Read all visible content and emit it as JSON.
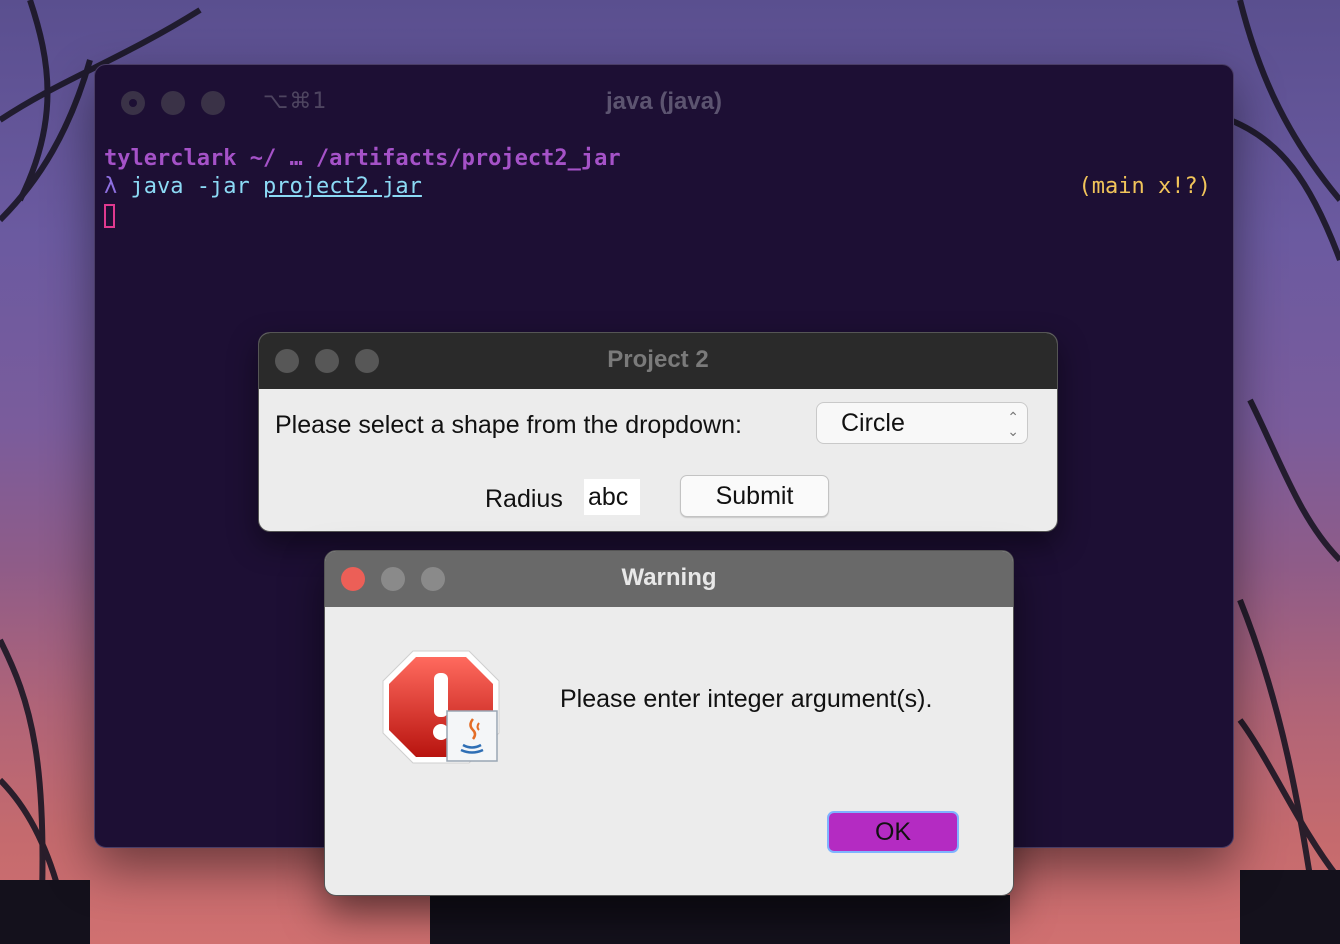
{
  "terminal": {
    "title": "java (java)",
    "shortcut": "⌥⌘1",
    "user": "tylerclark",
    "path": "~/ … /artifacts/project2_jar",
    "lambda": "λ",
    "command": "java -jar",
    "command_arg": "project2.jar",
    "git_status": "(main x!?)"
  },
  "project_window": {
    "title": "Project 2",
    "shape_label": "Please select a shape from the dropdown:",
    "shape_selected": "Circle",
    "radius_label": "Radius",
    "radius_value": "abc",
    "submit_label": "Submit"
  },
  "warning_dialog": {
    "title": "Warning",
    "message": "Please enter integer argument(s).",
    "ok_label": "OK",
    "icon": "error-stop-java-icon"
  },
  "colors": {
    "terminal_bg": "#1d0f34",
    "prompt": "#a552c8",
    "command": "#8cdaf5",
    "git": "#f1c45a",
    "ok_button": "#b42bc2"
  }
}
